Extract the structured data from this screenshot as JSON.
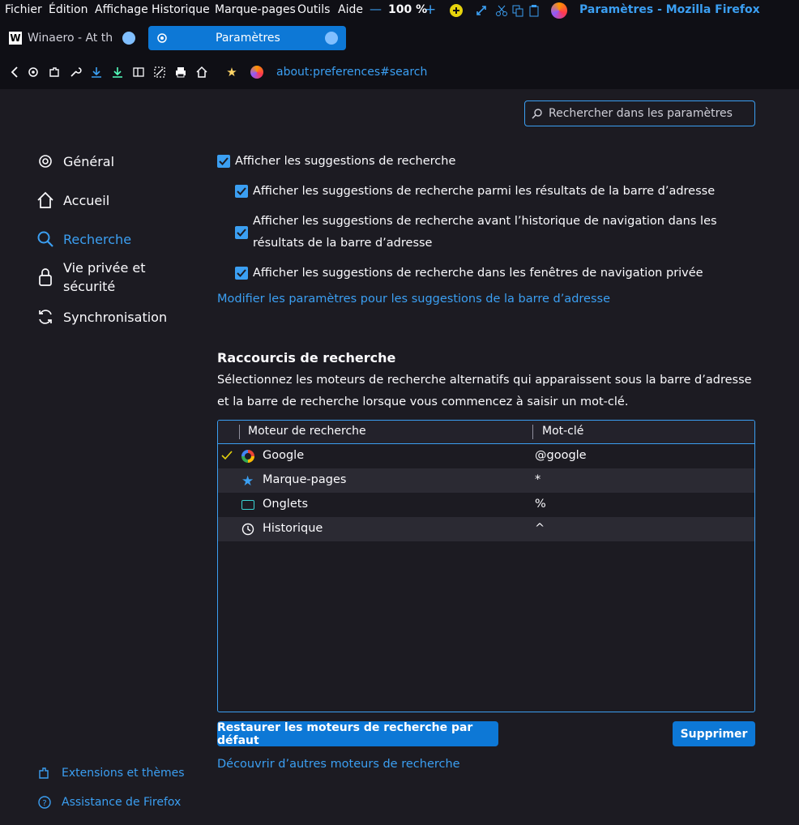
{
  "menubar": {
    "items": [
      "Fichier",
      "Édition",
      "Affichage",
      "Historique",
      "Marque-pages",
      "Outils",
      "Aide"
    ],
    "zoom_minus": "—",
    "zoom": "100 %",
    "zoom_plus": "+",
    "window_title": "Paramètres - Mozilla Firefox"
  },
  "tabs": [
    {
      "label": "Winaero - At the",
      "favicon": "W"
    },
    {
      "label": "Paramètres"
    }
  ],
  "navbar": {
    "url": "about:preferences#search"
  },
  "search": {
    "placeholder": "Rechercher dans les paramètres"
  },
  "sidebar": {
    "items": [
      {
        "label": "Général",
        "icon": "gear-icon"
      },
      {
        "label": "Accueil",
        "icon": "home-icon"
      },
      {
        "label": "Recherche",
        "icon": "search-icon"
      },
      {
        "label": "Vie privée et sécurité",
        "icon": "lock-icon"
      },
      {
        "label": "Synchronisation",
        "icon": "sync-icon"
      }
    ],
    "footer": [
      {
        "label": "Extensions et thèmes",
        "icon": "puzzle-icon"
      },
      {
        "label": "Assistance de Firefox",
        "icon": "help-icon"
      }
    ]
  },
  "suggestions": {
    "main": "Afficher les suggestions de recherche",
    "sub1": "Afficher les suggestions de recherche parmi les résultats de la barre d’adresse",
    "sub2": "Afficher les suggestions de recherche avant l’historique de navigation dans les résultats de la barre d’adresse",
    "sub3": "Afficher les suggestions de recherche dans les fenêtres de navigation privée",
    "link": "Modifier les paramètres pour les suggestions de la barre d’adresse"
  },
  "shortcuts": {
    "title": "Raccourcis de recherche",
    "description": "Sélectionnez les moteurs de recherche alternatifs qui apparaissent sous la barre d’adresse et la barre de recherche lorsque vous commencez à saisir un mot-clé.",
    "columns": [
      "Moteur de recherche",
      "Mot-clé"
    ],
    "rows": [
      {
        "name": "Google",
        "keyword": "@google",
        "icon": "google-icon",
        "checked": true
      },
      {
        "name": "Marque-pages",
        "keyword": "*",
        "icon": "star-icon",
        "checked": false
      },
      {
        "name": "Onglets",
        "keyword": "%",
        "icon": "tab-icon",
        "checked": false
      },
      {
        "name": "Historique",
        "keyword": "^",
        "icon": "clock-icon",
        "checked": false
      }
    ],
    "restore_button": "Restaurer les moteurs de recherche par défaut",
    "delete_button": "Supprimer",
    "discover_link": "Découvrir d’autres moteurs de recherche"
  },
  "colors": {
    "background": "#1c1b22",
    "accent": "#3b9ff2",
    "button": "#0d78d6"
  }
}
